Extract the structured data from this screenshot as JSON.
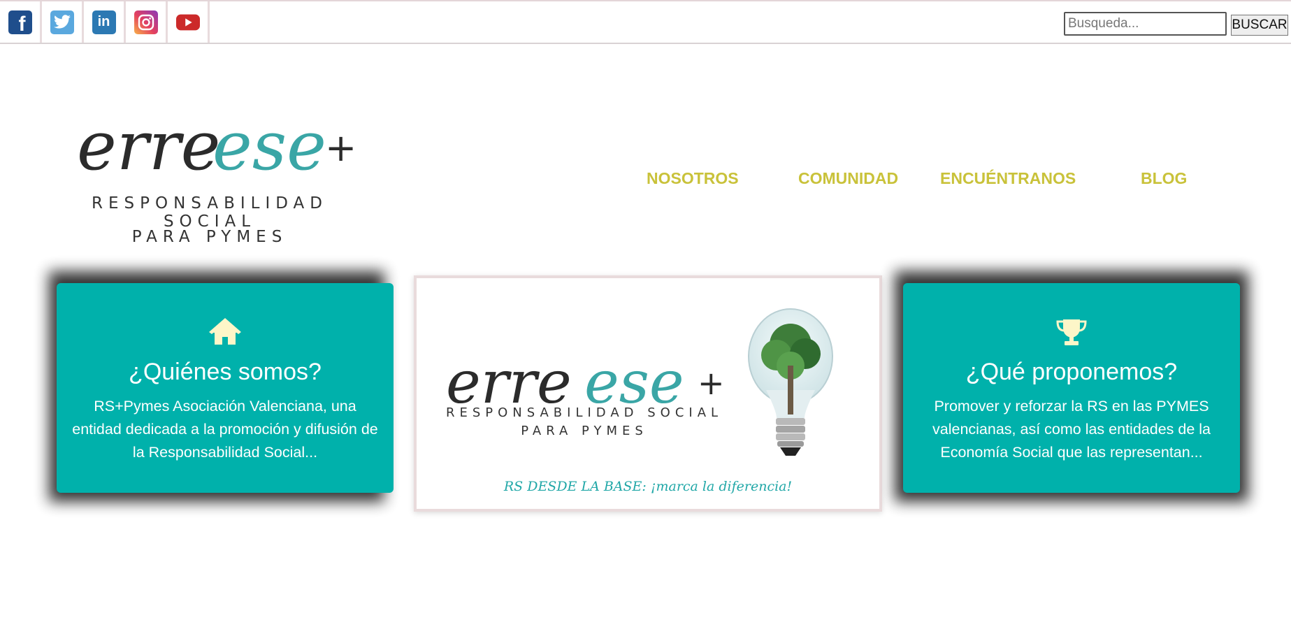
{
  "social": [
    {
      "name": "facebook",
      "glyph": "f"
    },
    {
      "name": "twitter",
      "glyph": ""
    },
    {
      "name": "linkedin",
      "glyph": "in"
    },
    {
      "name": "instagram",
      "glyph": ""
    },
    {
      "name": "youtube",
      "glyph": ""
    }
  ],
  "search": {
    "placeholder": "Busqueda...",
    "button": "BUSCAR"
  },
  "logo": {
    "script_dark": "erre",
    "script_teal": "ese",
    "plus": "+",
    "line1": "RESPONSABILIDAD SOCIAL",
    "line2": "PARA PYMES"
  },
  "nav": [
    "NOSOTROS",
    "COMUNIDAD",
    "ENCUÉNTRANOS",
    "BLOG"
  ],
  "cards": [
    {
      "icon": "home-icon",
      "title": "¿Quiénes somos?",
      "text": "RS+Pymes Asociación Valenciana, una entidad dedicada a la promoción y difusión de la Responsabilidad Social..."
    },
    {
      "icon": "trophy-icon",
      "title": "¿Qué proponemos?",
      "text": "Promover y reforzar la RS en las PYMES valencianas, así como las entidades de la Economía Social que las representan..."
    }
  ],
  "banner": {
    "line1": "RESPONSABILIDAD SOCIAL",
    "line2": "PARA PYMES",
    "tagline": "RS DESDE LA BASE: ¡marca la diferencia!"
  },
  "colors": {
    "teal": "#00b1ab",
    "nav": "#c9c23a",
    "logo_teal": "#3aa6a6",
    "logo_dark": "#2b2b2b"
  }
}
